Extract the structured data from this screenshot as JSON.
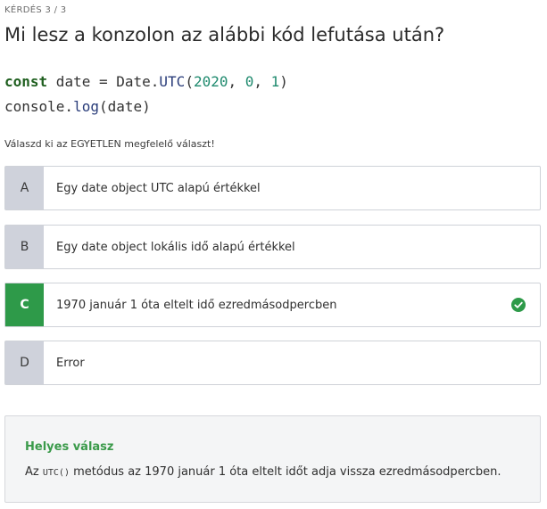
{
  "header": {
    "counter": "KÉRDÉS 3 / 3",
    "title": "Mi lesz a konzolon az alábbi kód lefutása után?"
  },
  "code": {
    "line1": {
      "keyword": "const",
      "text1": " date = Date.",
      "method": "UTC",
      "open": "(",
      "arg1": "2020",
      "sep1": ", ",
      "arg2": "0",
      "sep2": ", ",
      "arg3": "1",
      "close": ")"
    },
    "line2": {
      "obj": "console.",
      "method": "log",
      "args": "(date)"
    }
  },
  "instruction": "Válaszd ki az EGYETLEN megfelelő választ!",
  "options": [
    {
      "letter": "A",
      "text": "Egy date object UTC alapú értékkel",
      "correct": false
    },
    {
      "letter": "B",
      "text": "Egy date object lokális idő alapú értékkel",
      "correct": false
    },
    {
      "letter": "C",
      "text": "1970 január 1 óta eltelt idő ezredmásodpercben",
      "correct": true
    },
    {
      "letter": "D",
      "text": "Error",
      "correct": false
    }
  ],
  "explanation": {
    "title": "Helyes válasz",
    "prefix": "Az ",
    "code": "UTC()",
    "suffix": " metódus az 1970 január 1 óta eltelt időt adja vissza ezredmásodpercben."
  },
  "colors": {
    "accent_green": "#2e9a49",
    "letter_bg": "#cfd2db",
    "explain_bg": "#f4f5f6"
  },
  "icons": {
    "correct_marker": "check-circle-icon"
  }
}
